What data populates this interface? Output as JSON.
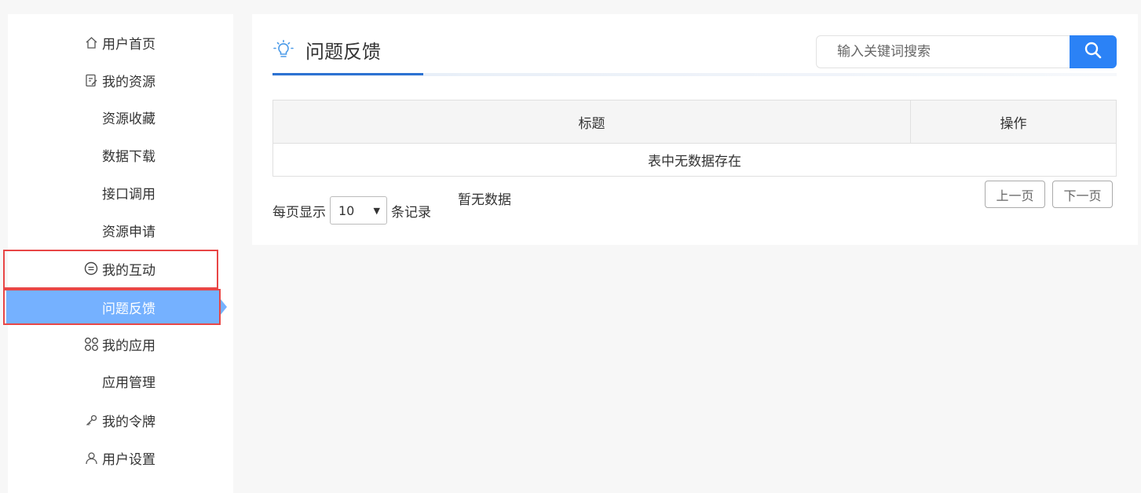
{
  "sidebar": {
    "items": [
      {
        "label": "用户首页",
        "icon": "home-icon",
        "type": "group"
      },
      {
        "label": "我的资源",
        "icon": "edit-document-icon",
        "type": "group"
      },
      {
        "label": "资源收藏",
        "type": "sub"
      },
      {
        "label": "数据下载",
        "type": "sub"
      },
      {
        "label": "接口调用",
        "type": "sub"
      },
      {
        "label": "资源申请",
        "type": "sub"
      },
      {
        "label": "我的互动",
        "icon": "chat-bubble-icon",
        "type": "group"
      },
      {
        "label": "问题反馈",
        "type": "sub",
        "active": true
      },
      {
        "label": "我的应用",
        "icon": "command-key-icon",
        "type": "group"
      },
      {
        "label": "应用管理",
        "type": "sub"
      },
      {
        "label": "我的令牌",
        "icon": "key-icon",
        "type": "group"
      },
      {
        "label": "用户设置",
        "icon": "user-icon",
        "type": "group"
      }
    ]
  },
  "main": {
    "title": "问题反馈",
    "title_icon": "lightbulb-icon",
    "search": {
      "placeholder": "输入关键词搜索",
      "button_icon": "search-icon"
    },
    "table": {
      "columns": [
        "标题",
        "操作"
      ],
      "empty_text": "表中无数据存在"
    },
    "length": {
      "prefix": "每页显示",
      "value": "10",
      "suffix": "条记录"
    },
    "info": "暂无数据",
    "pager": {
      "prev": "上一页",
      "next": "下一页"
    }
  },
  "colors": {
    "accent": "#2b82f6",
    "active_bg": "#75b1ff",
    "highlight": "#e84646",
    "underline": "#2c72d2"
  }
}
